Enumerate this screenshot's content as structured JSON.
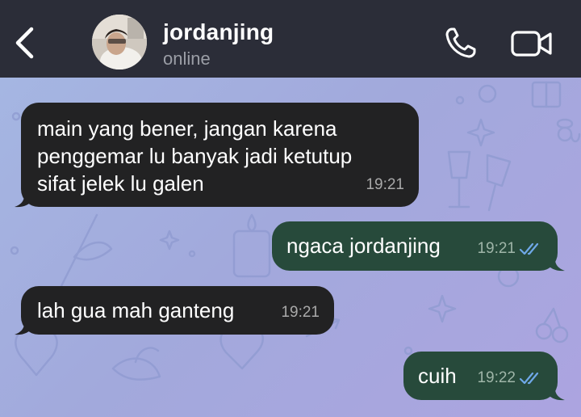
{
  "header": {
    "contact_name": "jordanjing",
    "status": "online"
  },
  "messages": [
    {
      "direction": "incoming",
      "text": "main yang bener, jangan karena\npenggemar lu banyak jadi ketutup\nsifat jelek lu galen",
      "time": "19:21"
    },
    {
      "direction": "outgoing",
      "text": "ngaca jordanjing",
      "time": "19:21",
      "status": "read"
    },
    {
      "direction": "incoming",
      "text": "lah gua mah ganteng",
      "time": "19:21"
    },
    {
      "direction": "outgoing",
      "text": "cuih",
      "time": "19:22",
      "status": "read"
    }
  ],
  "icons": {
    "back": "chevron-left-icon",
    "call": "phone-icon",
    "video": "video-camera-icon",
    "read_receipt": "double-check-icon"
  },
  "colors": {
    "header_bg": "#2b2d38",
    "incoming_bubble": "#222223",
    "outgoing_bubble": "#274a3b",
    "read_check": "#6fa8e8"
  }
}
